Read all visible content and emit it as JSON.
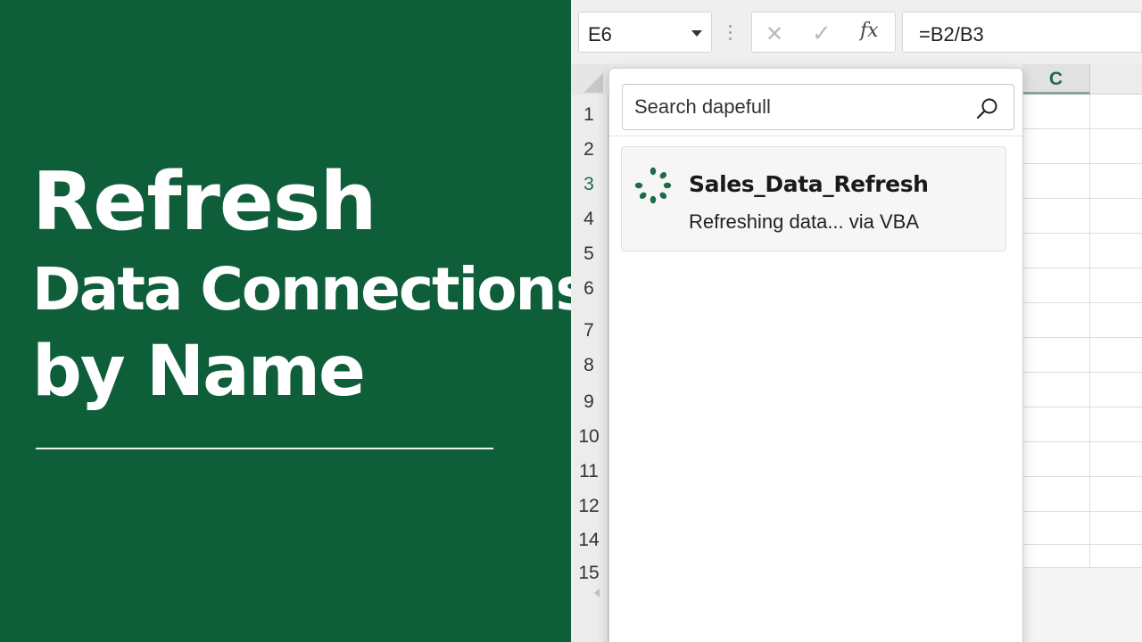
{
  "banner": {
    "title_line1": "Refresh",
    "title_line2": "Data Connections",
    "title_line3": "by Name",
    "background_color": "#0f5e3a"
  },
  "toolbar": {
    "name_box_value": "E6",
    "cancel_icon": "x-icon",
    "enter_icon": "check-icon",
    "fx_label": "fx",
    "formula_value": "=B2/B3"
  },
  "grid": {
    "columns": [
      "C"
    ],
    "active_column": "C",
    "rows": [
      "1",
      "2",
      "3",
      "4",
      "5",
      "6",
      "7",
      "8",
      "9",
      "10",
      "11",
      "12",
      "14",
      "15"
    ],
    "active_row": "3",
    "accent_color": "#1e6b45"
  },
  "dropdown": {
    "search_placeholder": "Search dapefull",
    "search_icon": "search-icon",
    "results": [
      {
        "icon": "loading-spinner-icon",
        "title": "Sales_Data_Refresh",
        "status": "Refreshing data... via VBA"
      }
    ]
  }
}
